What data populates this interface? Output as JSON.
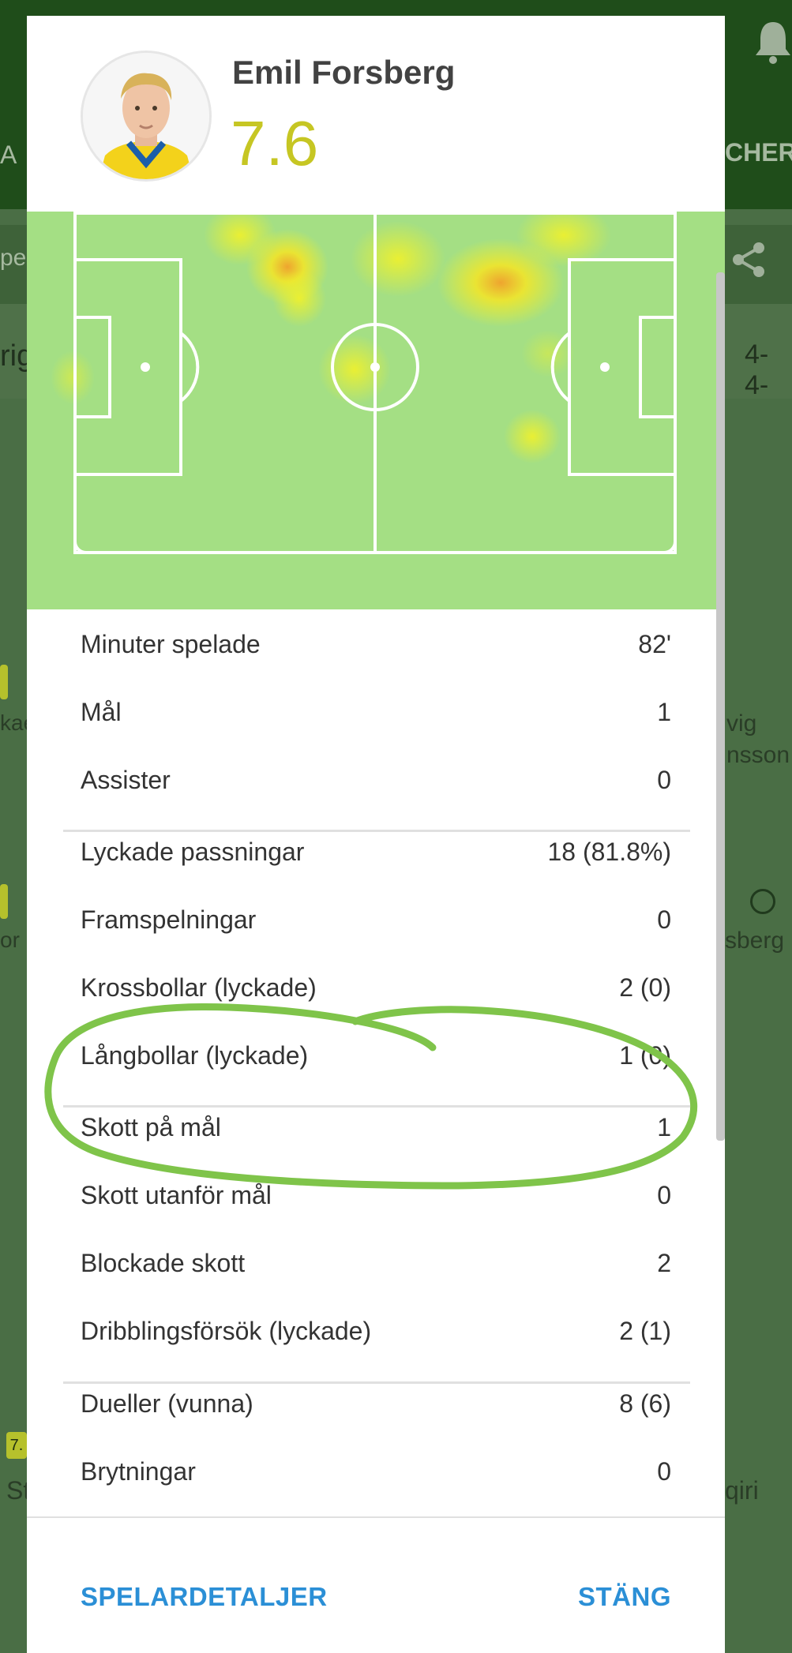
{
  "background": {
    "tab_right_text": "CHER",
    "left_letter": "A",
    "subbar_left_text": "pel",
    "formation_text": "4-4-",
    "row_left_text": "rig",
    "player_fragments": [
      {
        "text": "kae",
        "top": 0
      },
      {
        "text": "vig",
        "top": 0
      },
      {
        "text": "nsson",
        "top": 0
      },
      {
        "text": "or",
        "top": 0
      },
      {
        "text": "sberg",
        "top": 0
      },
      {
        "text": "St",
        "top": 0
      },
      {
        "text": "qiri",
        "top": 0
      }
    ],
    "badge_fragment": "7."
  },
  "dialog": {
    "player_name": "Emil Forsberg",
    "rating": "7.6",
    "rating_color": "#c6c623",
    "stats": [
      {
        "label": "Minuter spelade",
        "value": "82'"
      },
      {
        "label": "Mål",
        "value": "1"
      },
      {
        "label": "Assister",
        "value": "0"
      },
      {
        "label": "Lyckade passningar",
        "value": "18 (81.8%)"
      },
      {
        "label": "Framspelningar",
        "value": "0"
      },
      {
        "label": "Krossbollar (lyckade)",
        "value": "2 (0)"
      },
      {
        "label": "Långbollar (lyckade)",
        "value": "1 (0)"
      },
      {
        "label": "Skott på mål",
        "value": "1"
      },
      {
        "label": "Skott utanför mål",
        "value": "0"
      },
      {
        "label": "Blockade skott",
        "value": "2"
      },
      {
        "label": "Dribblingsförsök (lyckade)",
        "value": "2 (1)"
      },
      {
        "label": "Dueller (vunna)",
        "value": "8 (6)"
      },
      {
        "label": "Brytningar",
        "value": "0"
      }
    ],
    "buttons": {
      "details": "SPELARDETALJER",
      "close": "STÄNG"
    },
    "accent_color": "#2b8fd6"
  }
}
